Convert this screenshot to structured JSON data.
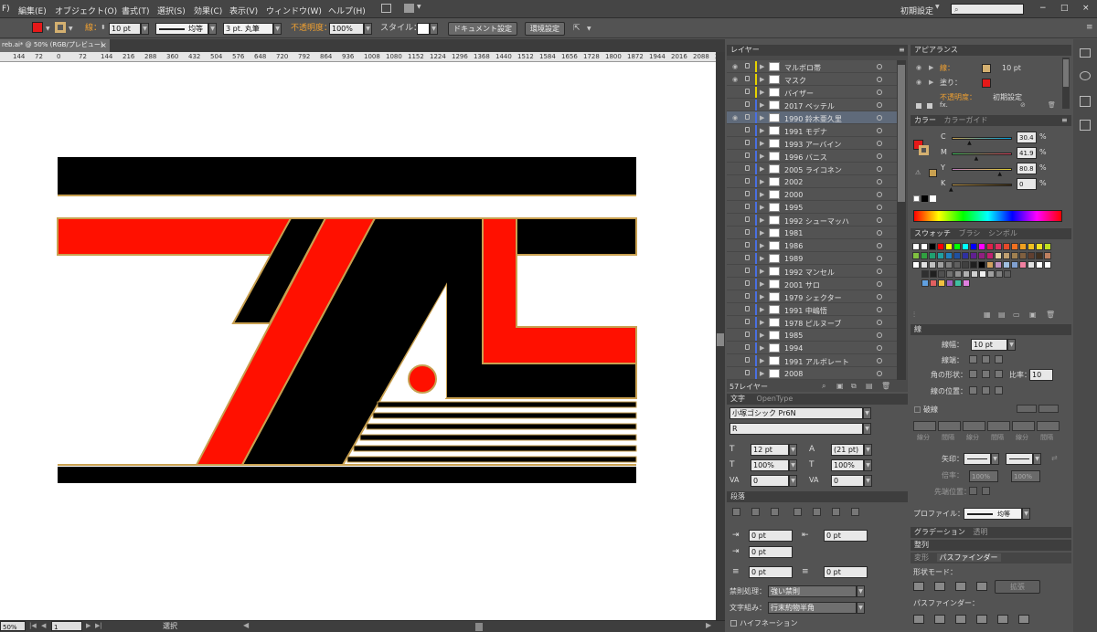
{
  "menu": {
    "items": [
      "F)",
      "編集(E)",
      "オブジェクト(O)",
      "書式(T)",
      "選択(S)",
      "効果(C)",
      "表示(V)",
      "ウィンドウ(W)",
      "ヘルプ(H)"
    ],
    "workspace": "初期設定",
    "search_icon": "search-icon",
    "window_buttons": [
      "−",
      "□",
      "×"
    ]
  },
  "control_bar": {
    "stroke_label": "線：",
    "stroke_value": "10 pt",
    "stroke_style": "均等",
    "brush_label": "3 pt. 丸筆",
    "opacity_label": "不透明度：",
    "opacity_value": "100%",
    "style_label": "スタイル：",
    "doc_settings_button": "ドキュメント設定",
    "prefs_button": "環境設定",
    "fill_color": "#e61919",
    "stroke_color": "#d4b070"
  },
  "document_tab": {
    "title": "reb.ai* @ 50% (RGB/プレビュー)",
    "close": "×"
  },
  "ruler": {
    "ticks": [
      "144",
      "72",
      "0",
      "72",
      "144",
      "216",
      "288",
      "360",
      "432",
      "504",
      "576",
      "648",
      "720",
      "792",
      "864",
      "936",
      "1008",
      "1080",
      "1152",
      "1224",
      "1296",
      "1368",
      "1440",
      "1512",
      "1584",
      "1656",
      "1728",
      "1800",
      "1872",
      "1944",
      "2016",
      "2088",
      "2"
    ]
  },
  "artwork": {
    "colors": {
      "red": "#ff1000",
      "black": "#000000",
      "white": "#ffffff",
      "gold": "#c8a050"
    }
  },
  "status_bar": {
    "zoom": "50%",
    "page": "1",
    "tool": "選択"
  },
  "layers_panel": {
    "title": "レイヤー",
    "count_label": "57レイヤー",
    "layers": [
      {
        "name": "マルボロ帯",
        "color": "#e6d200",
        "eye": true
      },
      {
        "name": "マスク",
        "color": "#e6d200",
        "eye": true
      },
      {
        "name": "バイザー",
        "color": "#e6d200",
        "eye": false
      },
      {
        "name": "2017 ベッテル",
        "color": "#4a6fe0",
        "eye": false
      },
      {
        "name": "1990 鈴木亜久里",
        "color": "#4a6fe0",
        "eye": true,
        "selected": true
      },
      {
        "name": "1991 モデナ",
        "color": "#4a6fe0",
        "eye": false
      },
      {
        "name": "1993 アーバイン",
        "color": "#4a6fe0",
        "eye": false
      },
      {
        "name": "1996 バニス",
        "color": "#4a6fe0",
        "eye": false
      },
      {
        "name": "2005 ライコネン",
        "color": "#4a6fe0",
        "eye": false
      },
      {
        "name": "2002",
        "color": "#4a6fe0",
        "eye": false
      },
      {
        "name": "2000",
        "color": "#4a6fe0",
        "eye": false
      },
      {
        "name": "1995",
        "color": "#4a6fe0",
        "eye": false
      },
      {
        "name": "1992 シューマッハ",
        "color": "#4a6fe0",
        "eye": false
      },
      {
        "name": "1981",
        "color": "#4a6fe0",
        "eye": false
      },
      {
        "name": "1986",
        "color": "#4a6fe0",
        "eye": false
      },
      {
        "name": "1989",
        "color": "#4a6fe0",
        "eye": false
      },
      {
        "name": "1992 マンセル",
        "color": "#4a6fe0",
        "eye": false
      },
      {
        "name": "2001 サロ",
        "color": "#4a6fe0",
        "eye": false
      },
      {
        "name": "1979 シェクター",
        "color": "#4a6fe0",
        "eye": false
      },
      {
        "name": "1991 中嶋悟",
        "color": "#4a6fe0",
        "eye": false
      },
      {
        "name": "1978 ピルヌーブ",
        "color": "#4a6fe0",
        "eye": false
      },
      {
        "name": "1985",
        "color": "#4a6fe0",
        "eye": false
      },
      {
        "name": "1994",
        "color": "#4a6fe0",
        "eye": false
      },
      {
        "name": "1991 アルボレート",
        "color": "#4a6fe0",
        "eye": false
      },
      {
        "name": "2008",
        "color": "#4a6fe0",
        "eye": false
      }
    ]
  },
  "character_panel": {
    "tabs": [
      "文字",
      "OpenType"
    ],
    "font_family": "小塚ゴシック Pr6N",
    "font_style": "R",
    "size": "12 pt",
    "leading": "(21 pt)",
    "vscale": "100%",
    "hscale": "100%",
    "tracking": "0",
    "kerning": "0"
  },
  "paragraph_panel": {
    "title": "段落",
    "left_indent": "0 pt",
    "right_indent": "0 pt",
    "first_indent": "0 pt",
    "space_before": "0 pt",
    "space_after": "0 pt",
    "kinsoku_label": "禁則処理：",
    "kinsoku_value": "強い禁則",
    "mojikumi_label": "文字組み：",
    "mojikumi_value": "行末約物半角",
    "hyphenation": "ハイフネーション"
  },
  "appearance_panel": {
    "title": "アピアランス",
    "stroke_label": "線：",
    "stroke_value": "10 pt",
    "fill_label": "塗り：",
    "opacity_label": "不透明度：",
    "opacity_value": "初期設定",
    "fx": "fx."
  },
  "color_panel": {
    "tabs": [
      "カラー",
      "カラーガイド"
    ],
    "C": "30.4",
    "M": "41.9",
    "Y": "80.8",
    "K": "0",
    "percent": "%",
    "C_fill": 0.304,
    "M_fill": 0.419,
    "Y_fill": 0.808,
    "K_fill": 0.0
  },
  "swatches_panel": {
    "tabs": [
      "スウォッチ",
      "ブラシ",
      "シンボル"
    ]
  },
  "stroke_panel": {
    "title": "線",
    "weight_label": "線幅：",
    "weight_value": "10 pt",
    "cap_label": "線端：",
    "corner_label": "角の形状：",
    "limit_label": "比率：",
    "limit_value": "10",
    "align_label": "線の位置：",
    "dashed_label": "破線",
    "dash_labels": [
      "線分",
      "間隔",
      "線分",
      "間隔",
      "線分",
      "間隔"
    ],
    "arrow_label": "矢印：",
    "scale_label": "倍率：",
    "scale_1": "100%",
    "scale_2": "100%",
    "tip_label": "先端位置：",
    "profile_label": "プロファイル：",
    "profile_value": "均等"
  },
  "gradient_panel": {
    "tabs": [
      "グラデーション",
      "透明"
    ]
  },
  "align_panel": {
    "title": "整列",
    "tabs": [
      "変形",
      "パスファインダー"
    ],
    "shape_mode_label": "形状モード：",
    "expand_button": "拡張",
    "pathfinder_label": "パスファインダー："
  }
}
